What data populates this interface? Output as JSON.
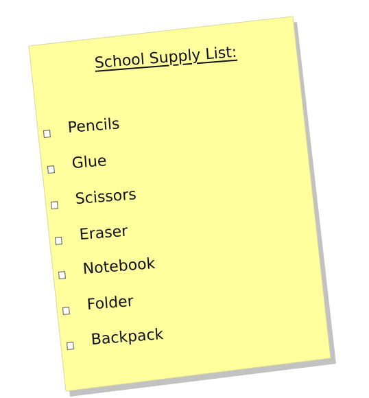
{
  "title": "School Supply List:",
  "items": [
    {
      "label": "Pencils",
      "checked": false
    },
    {
      "label": "Glue",
      "checked": false
    },
    {
      "label": "Scissors",
      "checked": false
    },
    {
      "label": "Eraser",
      "checked": false
    },
    {
      "label": "Notebook",
      "checked": false
    },
    {
      "label": "Folder",
      "checked": false
    },
    {
      "label": "Backpack",
      "checked": false
    }
  ],
  "colors": {
    "paper": "#ffff9e",
    "shadow": "#bdbdbd",
    "edge": "#d9d99a",
    "text": "#111111"
  }
}
